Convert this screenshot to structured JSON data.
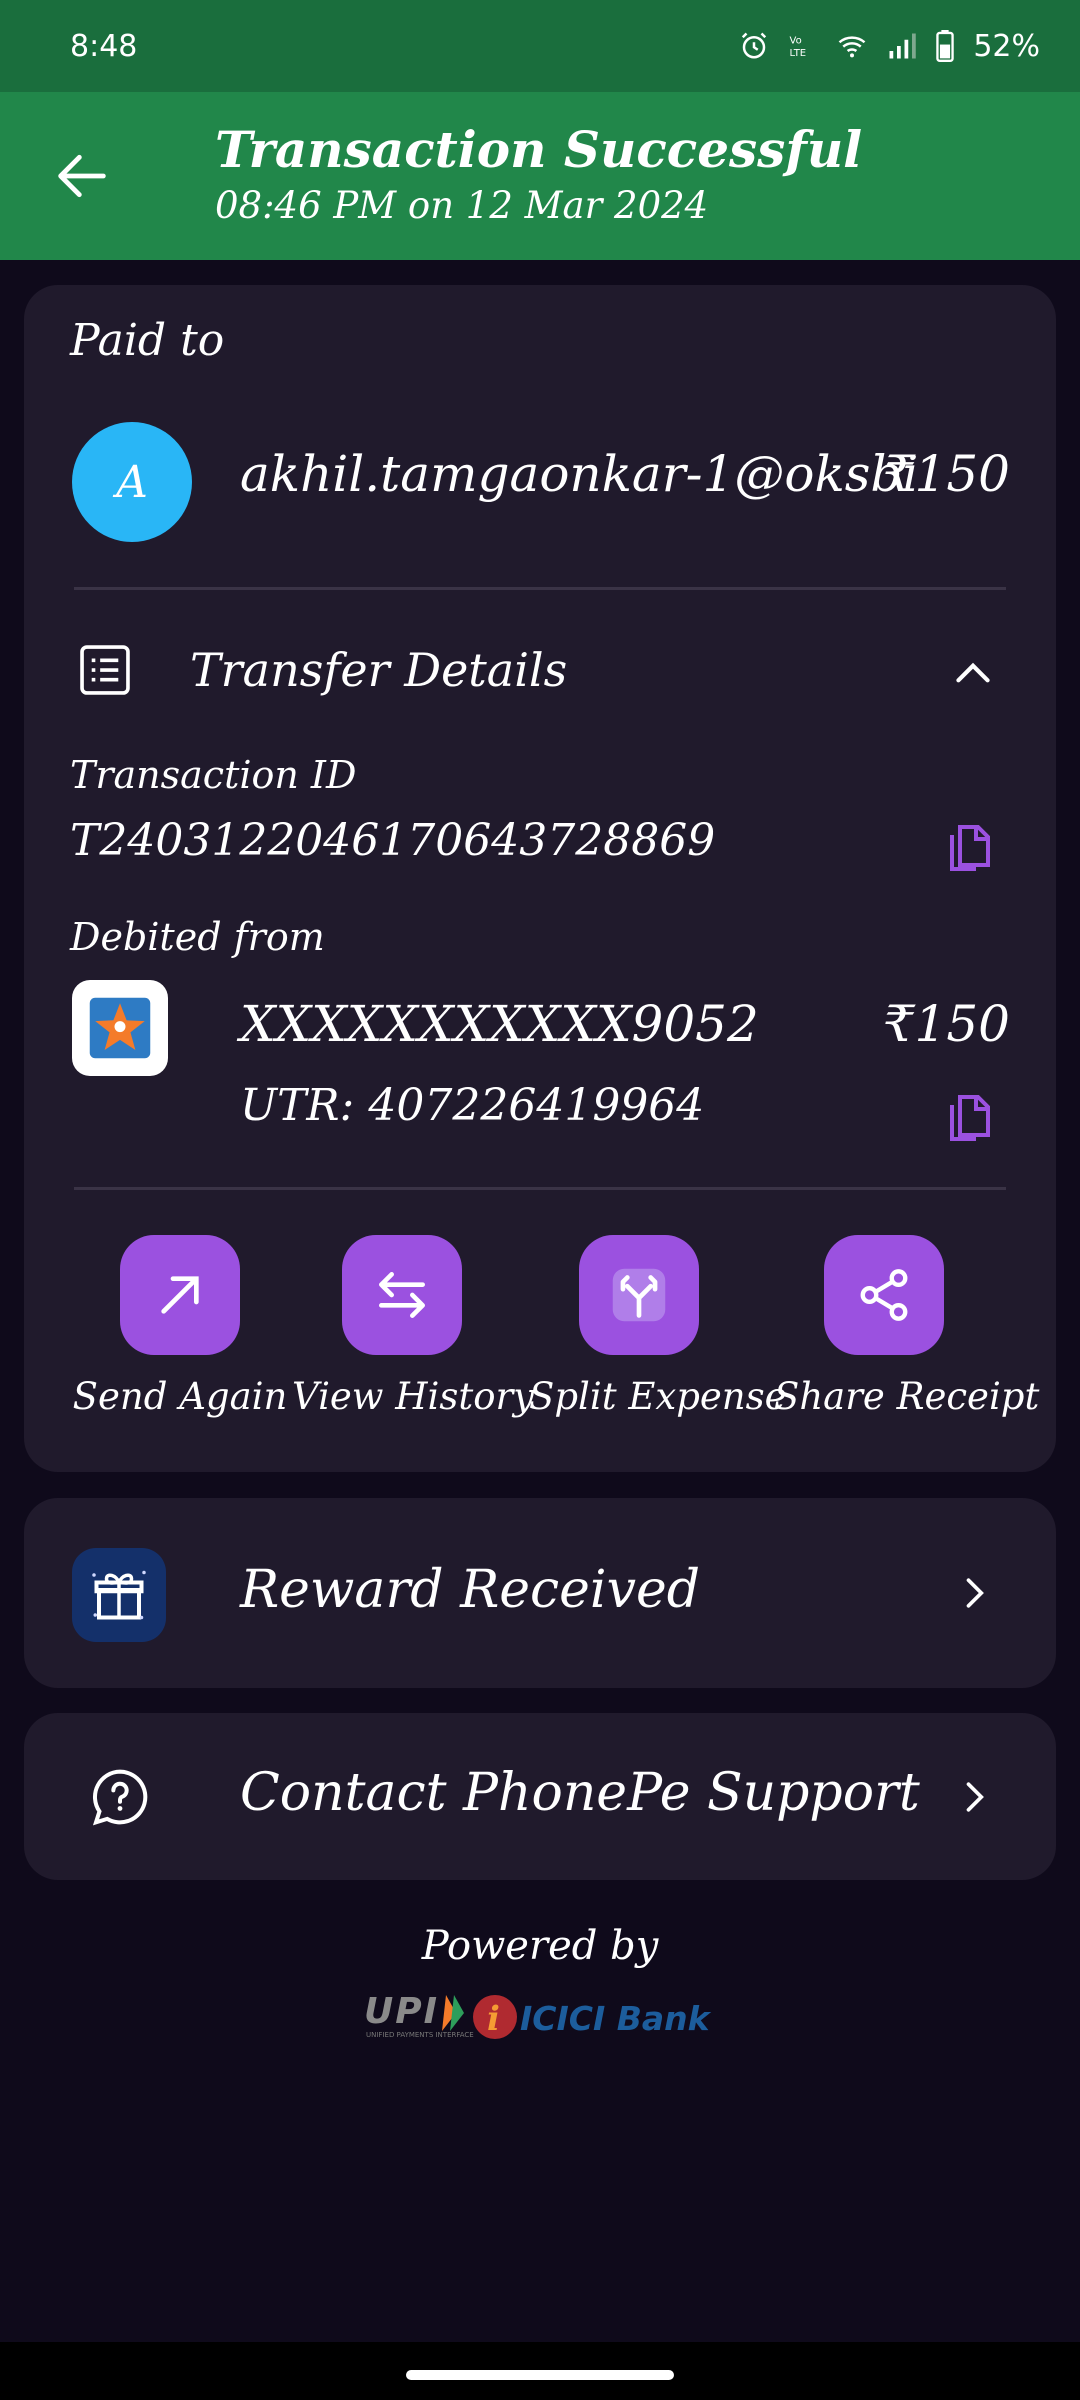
{
  "status_bar": {
    "time": "8:48",
    "battery": "52%"
  },
  "header": {
    "title": "Transaction Successful",
    "subtitle": "08:46 PM on 12 Mar 2024"
  },
  "paid_to": {
    "label": "Paid to",
    "avatar_letter": "A",
    "payee": "akhil.tamgaonkar-1@oksbi",
    "amount": "₹150"
  },
  "transfer_details": {
    "title": "Transfer Details",
    "transaction_id_label": "Transaction ID",
    "transaction_id": "T2403122046170643728869",
    "debited_from_label": "Debited from",
    "account": "XXXXXXXXXXX9052",
    "amount": "₹150",
    "utr": "UTR: 407226419964"
  },
  "actions": [
    {
      "label": "Send Again",
      "icon": "arrow-up-right-icon"
    },
    {
      "label": "View History",
      "icon": "swap-arrows-icon"
    },
    {
      "label": "Split Expense",
      "icon": "split-icon"
    },
    {
      "label": "Share Receipt",
      "icon": "share-icon"
    }
  ],
  "reward": {
    "label": "Reward Received"
  },
  "support": {
    "label": "Contact PhonePe Support"
  },
  "footer": {
    "powered_by": "Powered by",
    "upi_logo_text": "UPI",
    "bank_logo_text": "ICICI Bank"
  },
  "colors": {
    "accent_purple": "#9b51e0",
    "header_green": "#21874a",
    "status_green": "#1a6e3d",
    "card_bg": "#201a2c",
    "page_bg": "#0f0a1b",
    "avatar_blue": "#29b6f6"
  }
}
